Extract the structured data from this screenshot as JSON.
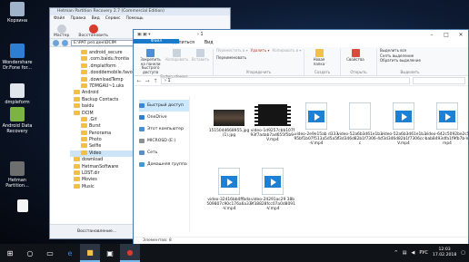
{
  "desktop": {
    "icons": [
      {
        "label": "Корзина"
      },
      {
        "label": "Wondershare Dr.Fone for..."
      },
      {
        "label": "dmpleform"
      },
      {
        "label": "Android Data Recovery"
      },
      {
        "label": "Hetman Partition..."
      }
    ]
  },
  "back_window": {
    "title": "Hetman Partition Recovery 2.7 (Commercial Edition)",
    "menu": [
      "Файл",
      "Правка",
      "Вид",
      "Сервис",
      "Помощь"
    ],
    "tools": [
      "Мастер",
      "Восстановить"
    ],
    "path": "E:\\PAT рез.ден\\DCIM",
    "tree": [
      "android_secure",
      ".com.baidu.frontia",
      ".dmplatform",
      ".dooddemobile.favorites",
      ".downloadTemp",
      "7DMGAU~1.uks",
      "Android",
      "Backup Contacts",
      "baidu",
      "DCIM",
      ".Gif",
      "Burst",
      "Panorama",
      "Photo",
      "Selfie",
      "Video",
      "download",
      "HetmanSoftware",
      "LOST.dir",
      "Movies",
      "Music"
    ],
    "status": "Восстановление..."
  },
  "explorer": {
    "qa": "▣ ▣ ▾",
    "tabs": [
      "Файл",
      "Главная",
      "Поделиться",
      "Вид"
    ],
    "ribbon": {
      "groups": [
        {
          "caption": "Буфер обмена",
          "items": [
            "Закрепить на панели быстрого доступа",
            "Копировать",
            "Вставить"
          ]
        },
        {
          "caption": "Упорядочить",
          "items": [
            "Переместить в ▾",
            "Копировать в ▾",
            "Удалить ▾",
            "Переименовать"
          ]
        },
        {
          "caption": "Создать",
          "items": [
            "Новая папка"
          ]
        },
        {
          "caption": "Открыть",
          "items": [
            "Свойства"
          ]
        },
        {
          "caption": "Выделить",
          "items": [
            "Выделить все",
            "Снять выделение",
            "Обратить выделение"
          ]
        }
      ]
    },
    "path": "› 1",
    "nav": [
      {
        "label": "Быстрый доступ",
        "color": "#3a86d9"
      },
      {
        "label": "OneDrive",
        "color": "#2f7fd1"
      },
      {
        "label": "Этот компьютер",
        "color": "#4a8fd4"
      },
      {
        "label": "MICROSD (E:)",
        "color": "#8a8f96"
      },
      {
        "label": "Сеть",
        "color": "#5c8fc7"
      },
      {
        "label": "Домашняя группа",
        "color": "#3f9ad0"
      }
    ],
    "files": [
      {
        "name": "1515044668955.jpg (1).jpg",
        "kind": "photo"
      },
      {
        "name": "video-1d9257cbb107f93f7adab7ad655f5b9-V.mp4",
        "kind": "video"
      },
      {
        "name": "video-2e9e15ab d33395bf1b07f513a5d5a5f-V.mp4",
        "kind": "vicon"
      },
      {
        "name": "video-52a6b3d61e1b3f3d346d82b1f7306-4cc",
        "kind": "doc"
      },
      {
        "name": "video-52a6b3d61e1b3f3d346d82b1f7306cc-V.mp4",
        "kind": "vicon"
      },
      {
        "name": "video-642c5092be2c5bab8493dfa1f9fb7b-V.mp4",
        "kind": "vicon"
      },
      {
        "name": "video-32416bb4ffbda509807c90c176a6a33-V.mp4",
        "kind": "vicon"
      },
      {
        "name": "video-24291ac29 38b9f38828fcc07a0d8091-V.mp4",
        "kind": "vicon"
      }
    ],
    "status": "Элементов: 8"
  },
  "taskbar": {
    "time": "12:03",
    "date": "17.02.2018",
    "lang": "РУС"
  }
}
